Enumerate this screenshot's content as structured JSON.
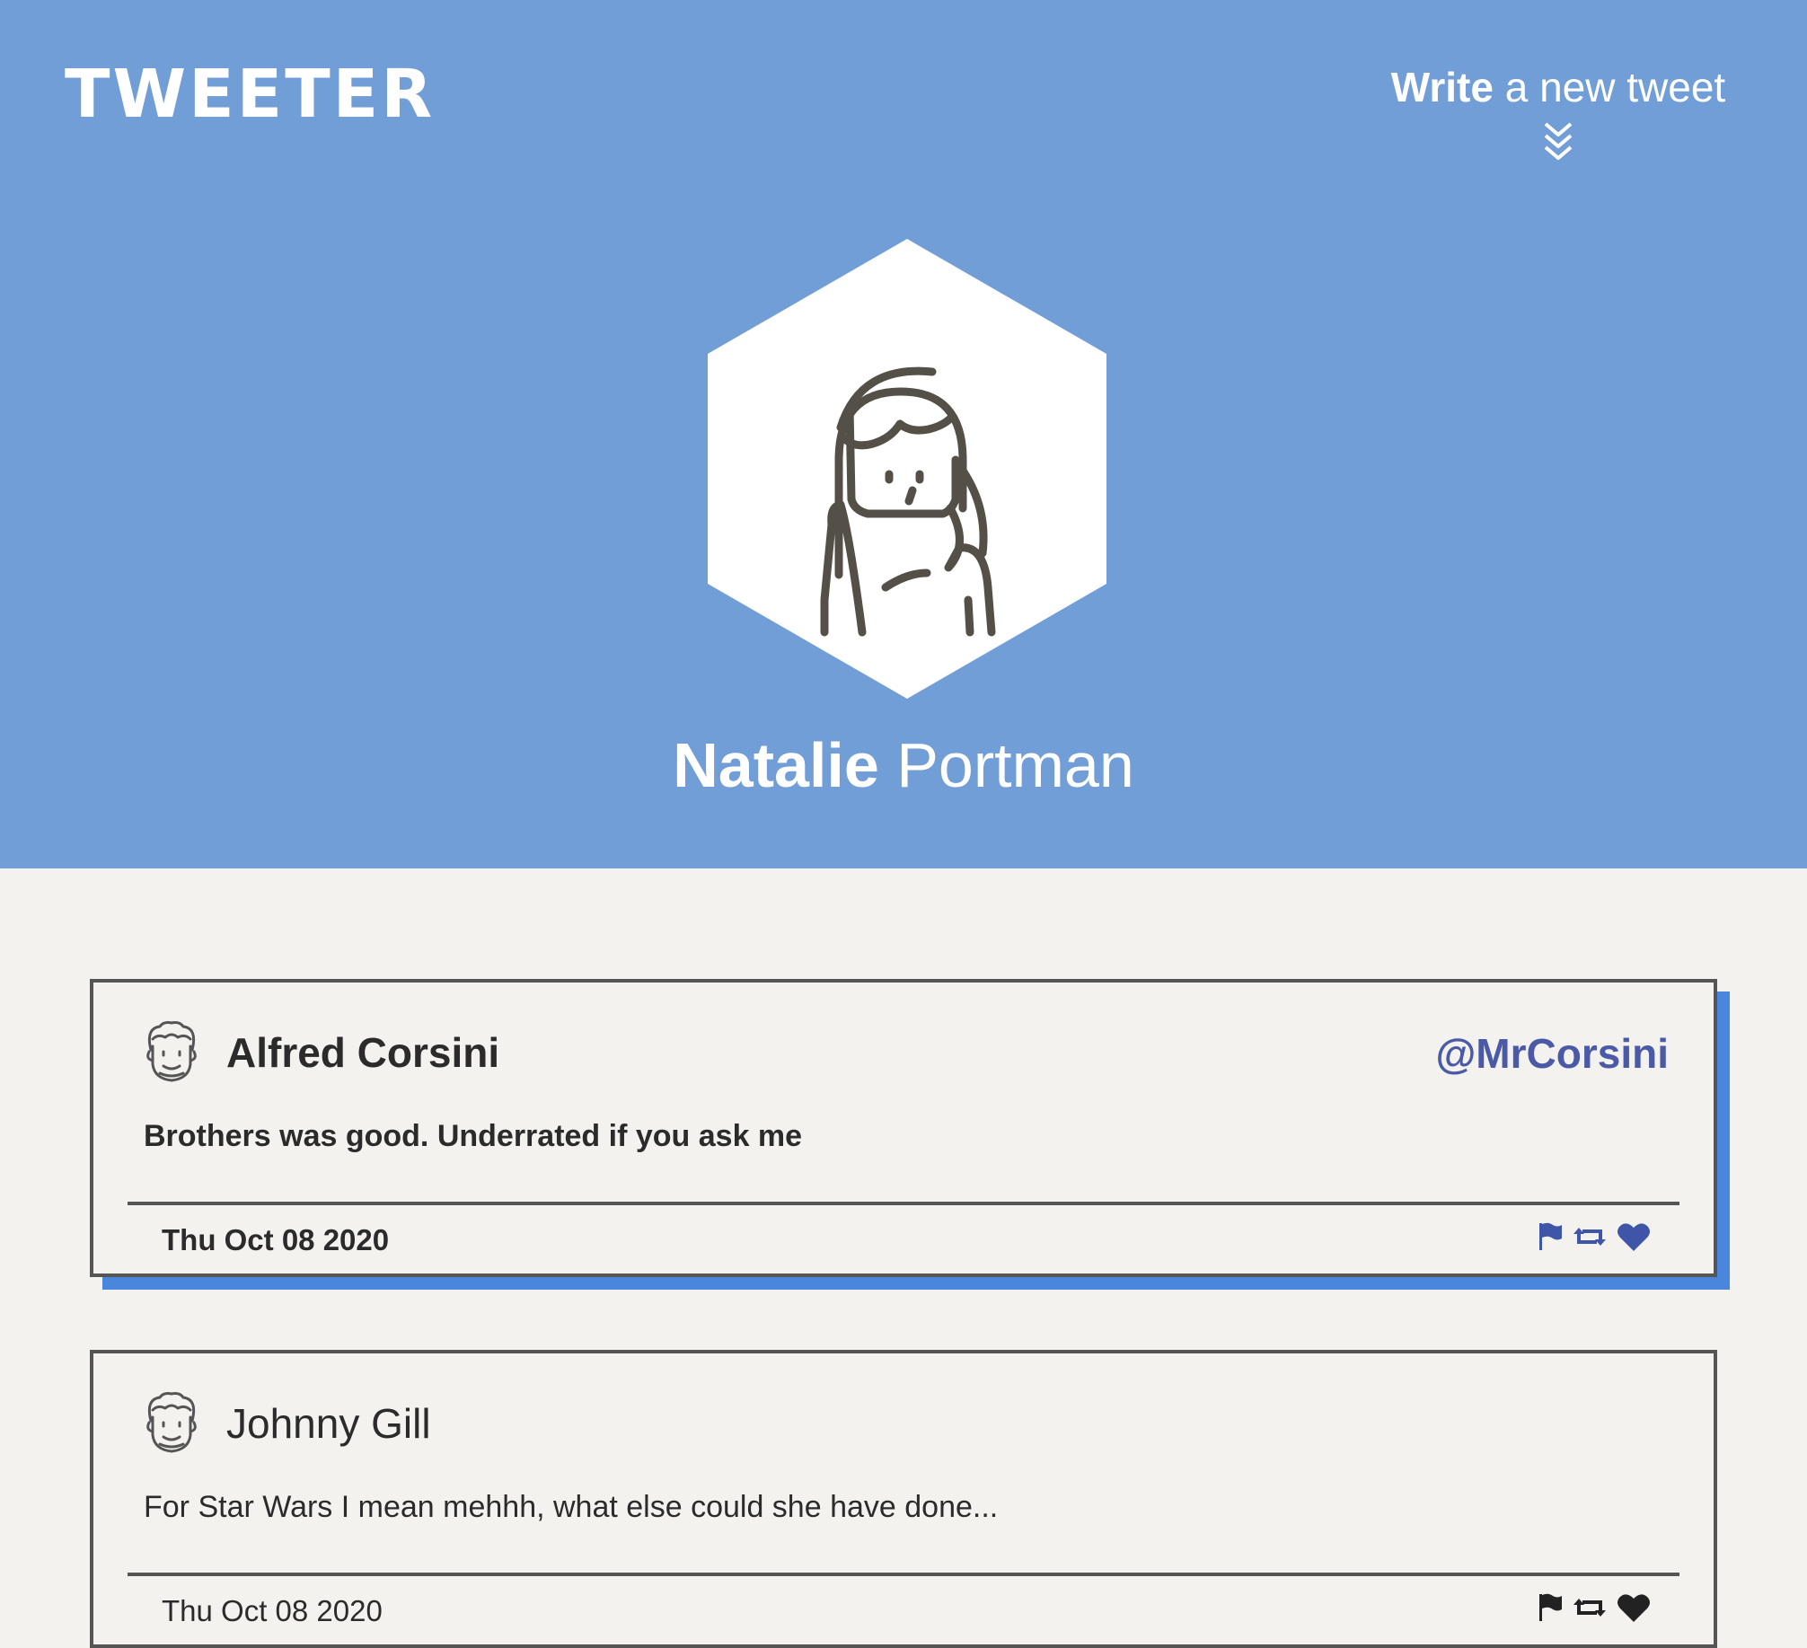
{
  "header": {
    "logo": "TWEETER",
    "compose_strong": "Write",
    "compose_rest": " a new tweet",
    "compose_arrow_icon": "chevrons-down-icon"
  },
  "profile": {
    "avatar_icon": "woman-avatar-icon",
    "first_name": "Natalie",
    "last_name": " Portman"
  },
  "colors": {
    "header_bg": "#719ed6",
    "page_bg": "#f4f2ef",
    "accent_shadow": "#4a86dc",
    "handle": "#4a5aa6",
    "border": "#555555"
  },
  "tweets": [
    {
      "name": "Alfred Corsini",
      "handle": "@MrCorsini",
      "text": "Brothers was good. Underrated if you ask me",
      "date": "Thu Oct 08 2020",
      "avatar_icon": "man-avatar-icon",
      "actions": [
        "flag-icon",
        "retweet-icon",
        "heart-icon"
      ],
      "actions_color": "#3f55a8"
    },
    {
      "name": "Johnny Gill",
      "handle": "",
      "text": "For Star Wars I mean mehhh, what else could she have done...",
      "date": "Thu Oct 08 2020",
      "avatar_icon": "man-avatar-icon",
      "actions": [
        "flag-icon",
        "retweet-icon",
        "heart-icon"
      ],
      "actions_color": "#222222"
    }
  ]
}
